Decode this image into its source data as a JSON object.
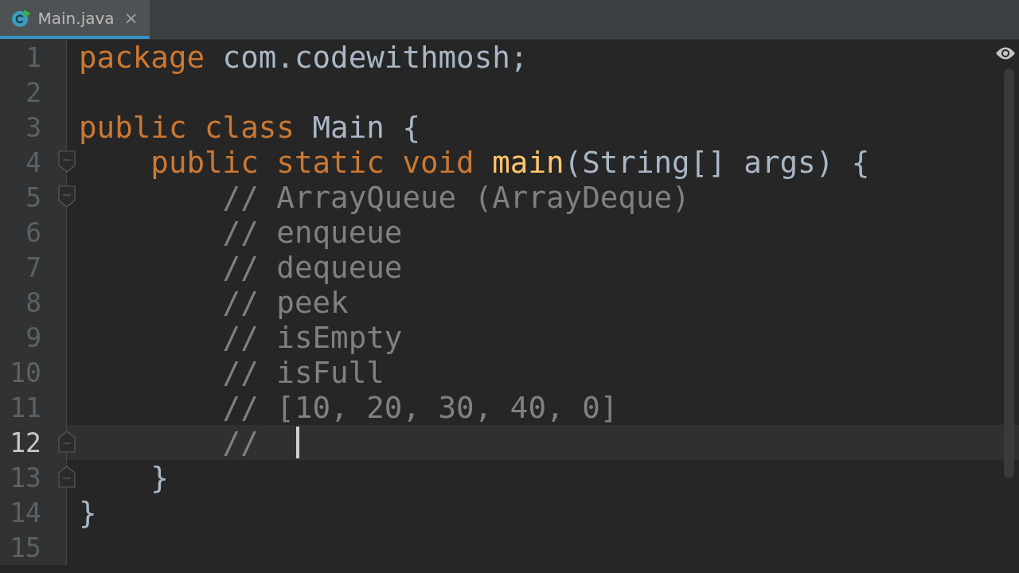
{
  "tabs": [
    {
      "label": "Main.java",
      "selected": true,
      "close": "×"
    }
  ],
  "editor": {
    "lines": [
      {
        "number": "1",
        "current": false,
        "fold_start": false,
        "fold_end": false,
        "tokens": [
          {
            "kind": "keyword",
            "text": "package"
          },
          {
            "kind": "plain",
            "text": " com.codewithmosh;"
          }
        ]
      },
      {
        "number": "2",
        "current": false,
        "fold_start": false,
        "fold_end": false
      },
      {
        "number": "3",
        "current": false,
        "fold_start": false,
        "fold_end": false,
        "tokens": [
          {
            "kind": "keyword",
            "text": "public class"
          },
          {
            "kind": "plain",
            "text": " Main {"
          }
        ]
      },
      {
        "number": "4",
        "current": false,
        "fold_start": true,
        "fold_end": false,
        "tokens": [
          {
            "kind": "keyword",
            "text": "    public static void "
          },
          {
            "kind": "method",
            "text": "main"
          },
          {
            "kind": "plain",
            "text": "(String[] args) {"
          }
        ]
      },
      {
        "number": "5",
        "current": false,
        "fold_start": true,
        "fold_end": false,
        "tokens": [
          {
            "kind": "comment",
            "text": "        // ArrayQueue (ArrayDeque)"
          }
        ]
      },
      {
        "number": "6",
        "current": false,
        "fold_start": false,
        "fold_end": false,
        "tokens": [
          {
            "kind": "comment",
            "text": "        // enqueue"
          }
        ]
      },
      {
        "number": "7",
        "current": false,
        "fold_start": false,
        "fold_end": false,
        "tokens": [
          {
            "kind": "comment",
            "text": "        // dequeue"
          }
        ]
      },
      {
        "number": "8",
        "current": false,
        "fold_start": false,
        "fold_end": false,
        "tokens": [
          {
            "kind": "comment",
            "text": "        // peek"
          }
        ]
      },
      {
        "number": "9",
        "current": false,
        "fold_start": false,
        "fold_end": false,
        "tokens": [
          {
            "kind": "comment",
            "text": "        // isEmpty"
          }
        ]
      },
      {
        "number": "10",
        "current": false,
        "fold_start": false,
        "fold_end": false,
        "tokens": [
          {
            "kind": "comment",
            "text": "        // isFull"
          }
        ]
      },
      {
        "number": "11",
        "current": false,
        "fold_start": false,
        "fold_end": false,
        "tokens": [
          {
            "kind": "comment",
            "text": "        // [10, 20, 30, 40, 0]"
          }
        ]
      },
      {
        "number": "12",
        "current": true,
        "fold_start": false,
        "fold_end": true,
        "tokens": [
          {
            "kind": "comment",
            "text": "        //  "
          }
        ]
      },
      {
        "number": "13",
        "current": false,
        "fold_start": false,
        "fold_end": true,
        "tokens": [
          {
            "kind": "plain",
            "text": "    }"
          }
        ]
      },
      {
        "number": "14",
        "current": false,
        "fold_start": false,
        "fold_end": false,
        "tokens": [
          {
            "kind": "plain",
            "text": "}"
          }
        ]
      },
      {
        "number": "15",
        "current": false,
        "fold_start": false,
        "fold_end": false
      }
    ]
  }
}
